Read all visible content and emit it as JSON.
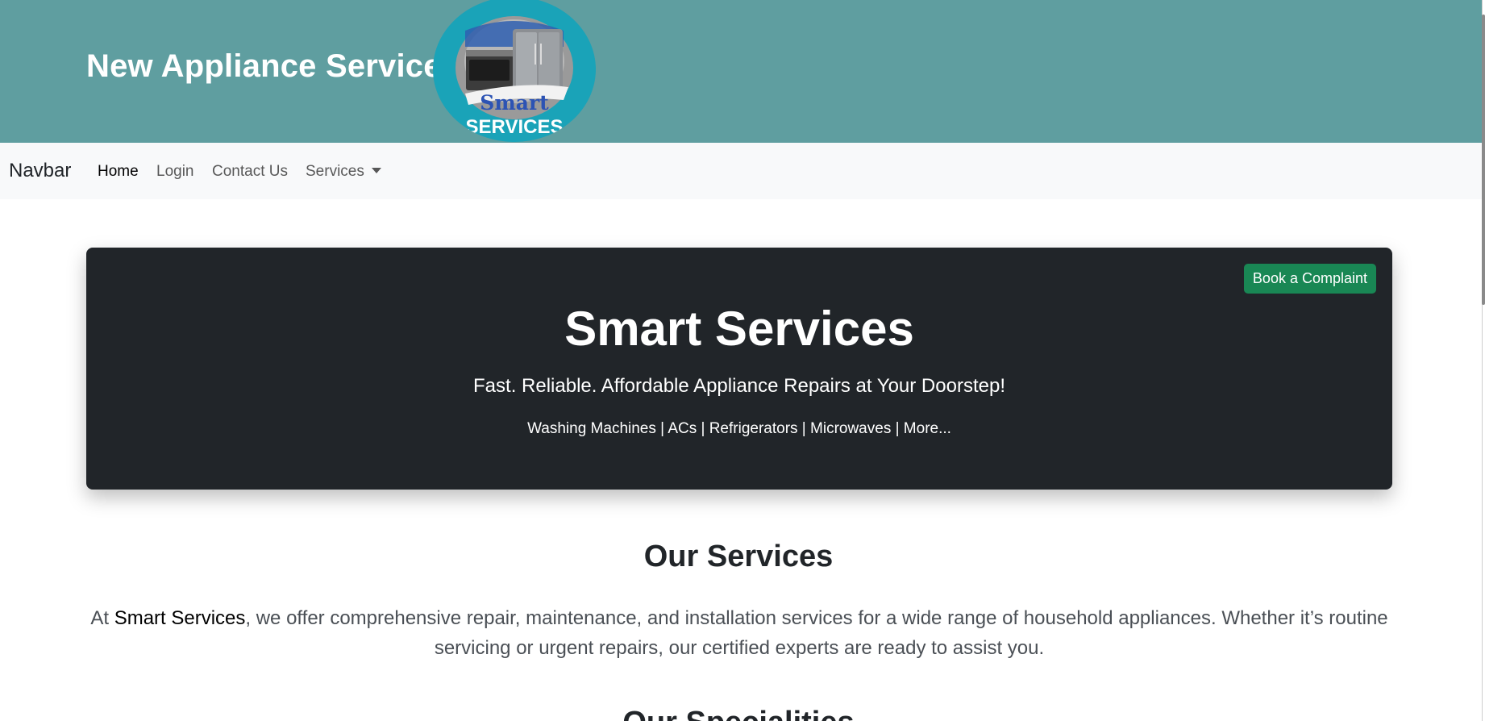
{
  "header": {
    "site_title": "New Appliance Services",
    "logo": {
      "line1": "Smart",
      "line2": "SERVICES"
    },
    "background_color": "#5f9ea0"
  },
  "navbar": {
    "brand": "Navbar",
    "links": [
      {
        "label": "Home",
        "active": true
      },
      {
        "label": "Login",
        "active": false
      },
      {
        "label": "Contact Us",
        "active": false
      },
      {
        "label": "Services",
        "active": false,
        "dropdown": true
      }
    ]
  },
  "hero": {
    "button_label": "Book a Complaint",
    "title": "Smart Services",
    "tagline": "Fast. Reliable. Affordable Appliance Repairs at Your Doorstep!",
    "appliances": "Washing Machines | ACs | Refrigerators | Microwaves | More...",
    "button_color": "#198754",
    "background_color": "#212529"
  },
  "services_section": {
    "title": "Our Services",
    "text_prefix": "At ",
    "text_highlight": "Smart Services",
    "text_suffix": ", we offer comprehensive repair, maintenance, and installation services for a wide range of household appliances. Whether it’s routine servicing or urgent repairs, our certified experts are ready to assist you."
  },
  "next_section": {
    "title": "Our Specialities"
  }
}
